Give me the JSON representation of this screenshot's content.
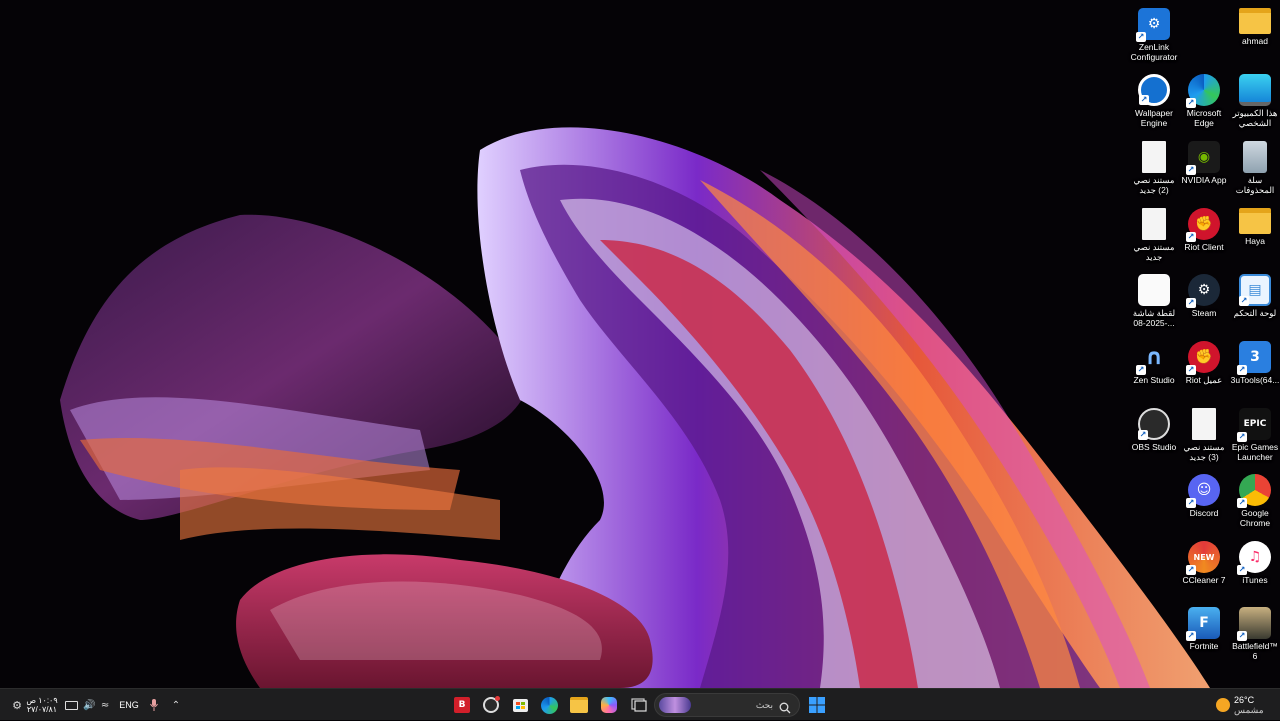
{
  "desktop": {
    "icons": [
      {
        "label": "ahmad",
        "icon": "folder-icon",
        "shortcut": false
      },
      {
        "label": "ZenLink Configurator",
        "icon": "zenlink-icon",
        "shortcut": true
      },
      {
        "label": "هذا الكمبيوتر الشخصي",
        "icon": "monitor-icon",
        "shortcut": false
      },
      {
        "label": "Microsoft Edge",
        "icon": "edge-icon",
        "shortcut": true
      },
      {
        "label": "Wallpaper Engine",
        "icon": "wallpaper-engine-icon",
        "shortcut": true
      },
      {
        "label": "سلة المحذوفات",
        "icon": "recycle-bin-icon",
        "shortcut": false
      },
      {
        "label": "NVIDIA App",
        "icon": "nvidia-icon",
        "shortcut": true
      },
      {
        "label": "مستند نصي (2) جديد",
        "icon": "text-document-icon",
        "shortcut": false
      },
      {
        "label": "Haya",
        "icon": "folder-icon",
        "shortcut": false
      },
      {
        "label": "Riot Client",
        "icon": "riot-client-icon",
        "shortcut": true
      },
      {
        "label": "مستند نصي جديد",
        "icon": "text-document-icon",
        "shortcut": false
      },
      {
        "label": "لوحة التحكم",
        "icon": "control-panel-icon",
        "shortcut": true
      },
      {
        "label": "Steam",
        "icon": "steam-icon",
        "shortcut": true
      },
      {
        "label": "لقطة شاشة 2025-08-...",
        "icon": "screenshot-image-icon",
        "shortcut": false
      },
      {
        "label": "3uTools(64...",
        "icon": "3utools-icon",
        "shortcut": true
      },
      {
        "label": "Riot عميل",
        "icon": "riot-client-icon",
        "shortcut": true
      },
      {
        "label": "Zen Studio",
        "icon": "zen-studio-icon",
        "shortcut": true
      },
      {
        "label": "Epic Games Launcher",
        "icon": "epic-games-icon",
        "shortcut": true
      },
      {
        "label": "مستند نصي (3) جديد",
        "icon": "text-document-icon",
        "shortcut": false
      },
      {
        "label": "OBS Studio",
        "icon": "obs-icon",
        "shortcut": true
      },
      {
        "label": "Google Chrome",
        "icon": "chrome-icon",
        "shortcut": true
      },
      {
        "label": "Discord",
        "icon": "discord-icon",
        "shortcut": true
      },
      {
        "label": "iTunes",
        "icon": "itunes-icon",
        "shortcut": true
      },
      {
        "label": "CCleaner 7",
        "icon": "ccleaner-icon",
        "shortcut": true
      },
      {
        "label": "Battlefield™ 6",
        "icon": "battlefield-icon",
        "shortcut": true
      },
      {
        "label": "Fortnite",
        "icon": "fortnite-icon",
        "shortcut": true
      }
    ]
  },
  "taskbar": {
    "weather": {
      "temp": "26°C",
      "condition": "مشمس",
      "icon": "sun-icon"
    },
    "start_icon": "windows-logo-icon",
    "search": {
      "placeholder": "بحث",
      "icon": "search-icon"
    },
    "apps": [
      {
        "name": "bitdefender-app",
        "icon": "bitdefender-icon"
      },
      {
        "name": "obs-app",
        "icon": "obs-icon"
      },
      {
        "name": "store-app",
        "icon": "store-icon"
      },
      {
        "name": "edge-app",
        "icon": "edge-icon"
      },
      {
        "name": "file-explorer-app",
        "icon": "folder-icon"
      },
      {
        "name": "copilot-app",
        "icon": "copilot-icon"
      },
      {
        "name": "task-view-app",
        "icon": "task-view-icon"
      }
    ],
    "tray": {
      "language": "ENG",
      "time": "١٠:٠٩ ص",
      "date": "٢٧/٠٧/٨١",
      "icons": [
        "chevron-up-icon",
        "microphone-icon",
        "wifi-icon",
        "speaker-icon",
        "battery-icon",
        "settings-icon"
      ]
    }
  },
  "colors": {
    "taskbar_bg": "#1e1e1f",
    "accent_blue": "#2b8ae8",
    "wallpaper_bg": "#050306"
  }
}
